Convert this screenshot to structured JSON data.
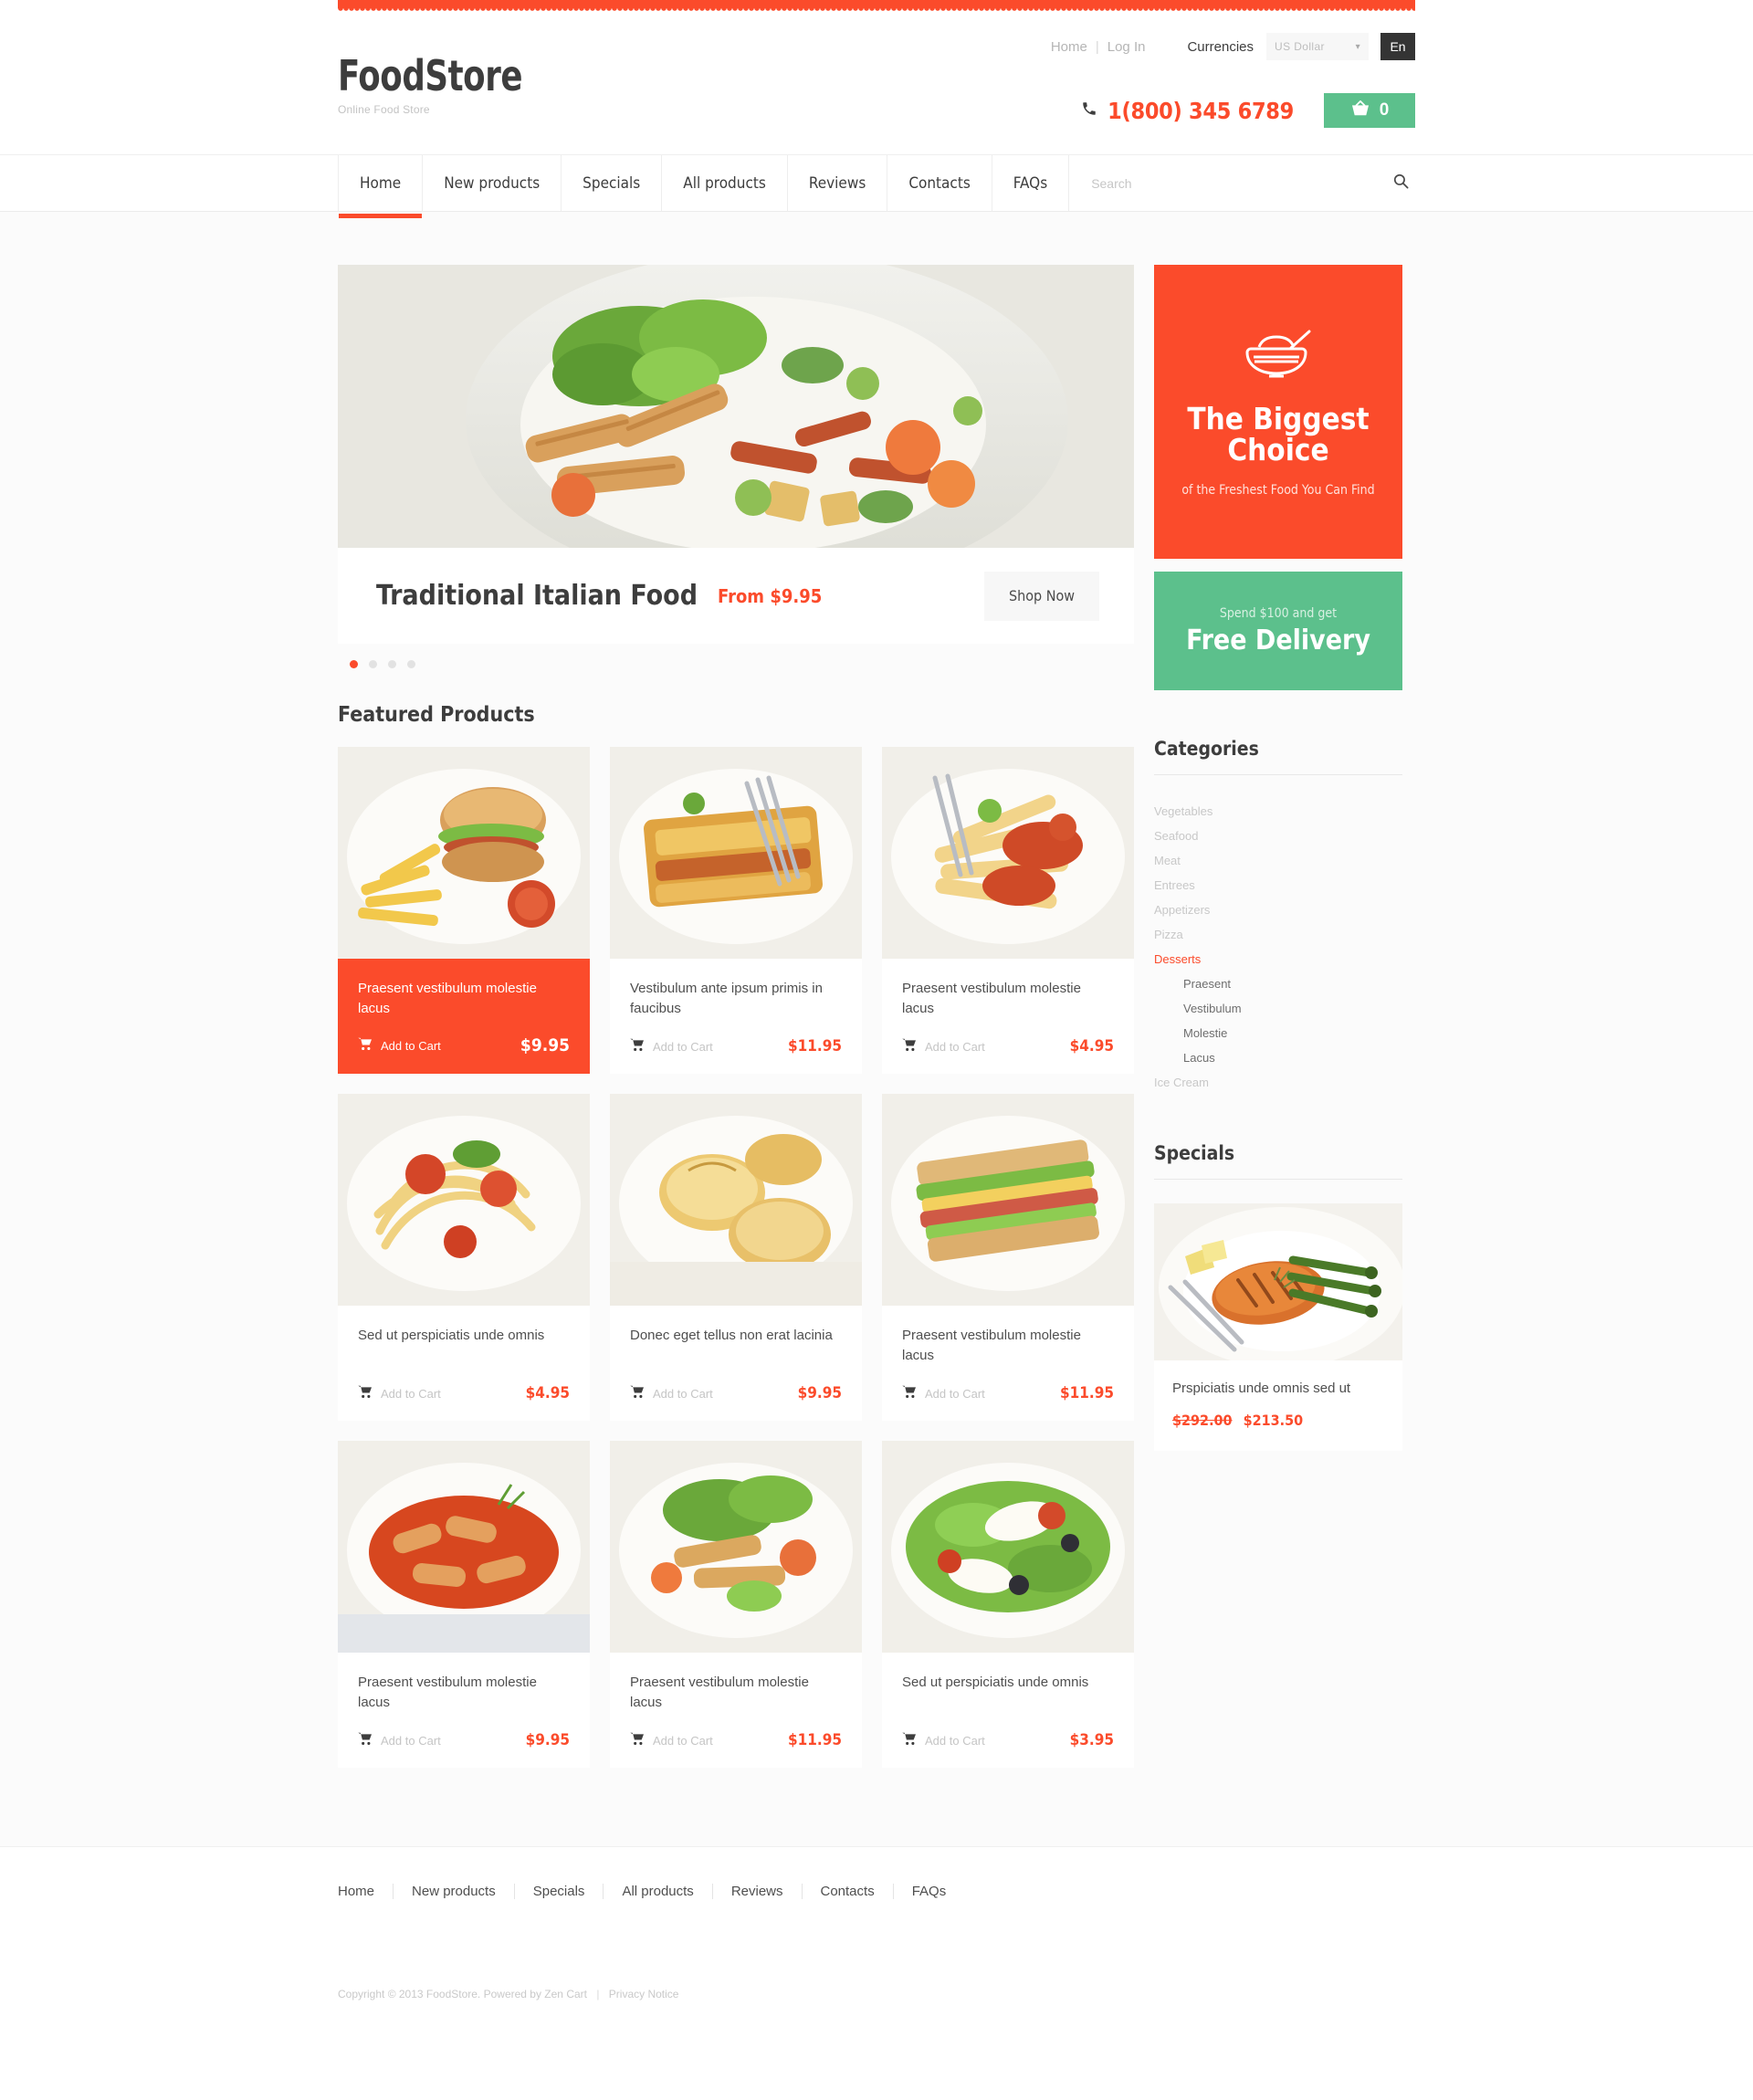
{
  "topbar": {
    "home_label": "Home",
    "separator": "|",
    "login_label": "Log In",
    "currencies_label": "Currencies",
    "currency_value": "US Dollar",
    "chevron": "⌄",
    "lang_label": "En"
  },
  "brand": {
    "title": "FoodStore",
    "tagline": "Online Food Store"
  },
  "contact": {
    "phone_icon": "phone-icon",
    "phone": "1(800) 345 6789",
    "cart_icon": "basket-icon",
    "cart_count": "0"
  },
  "nav": {
    "items": [
      {
        "label": "Home",
        "active": true
      },
      {
        "label": "New products",
        "active": false
      },
      {
        "label": "Specials",
        "active": false
      },
      {
        "label": "All products",
        "active": false
      },
      {
        "label": "Reviews",
        "active": false
      },
      {
        "label": "Contacts",
        "active": false
      },
      {
        "label": "FAQs",
        "active": false
      }
    ]
  },
  "search": {
    "placeholder": "Search",
    "icon": "search-icon"
  },
  "slider": {
    "title": "Traditional Italian Food",
    "price": "From $9.95",
    "button": "Shop Now",
    "dots": [
      true,
      false,
      false,
      false
    ]
  },
  "featured": {
    "heading": "Featured Products",
    "add_to_cart": "Add to Cart",
    "products": [
      {
        "title": "Praesent vestibulum molestie lacus",
        "price": "$9.95",
        "highlight": true
      },
      {
        "title": "Vestibulum ante ipsum primis in faucibus",
        "price": "$11.95",
        "highlight": false
      },
      {
        "title": "Praesent vestibulum molestie lacus",
        "price": "$4.95",
        "highlight": false
      },
      {
        "title": "Sed ut perspiciatis unde omnis",
        "price": "$4.95",
        "highlight": false
      },
      {
        "title": "Donec eget tellus non erat lacinia",
        "price": "$9.95",
        "highlight": false
      },
      {
        "title": "Praesent vestibulum molestie lacus",
        "price": "$11.95",
        "highlight": false
      },
      {
        "title": "Praesent vestibulum molestie lacus",
        "price": "$9.95",
        "highlight": false
      },
      {
        "title": "Praesent vestibulum molestie lacus",
        "price": "$11.95",
        "highlight": false
      },
      {
        "title": "Sed ut perspiciatis unde omnis",
        "price": "$3.95",
        "highlight": false
      }
    ]
  },
  "banners": {
    "orange": {
      "icon": "rice-bowl-icon",
      "line1": "The Biggest",
      "line2": "Choice",
      "sub": "of the Freshest Food You Can Find"
    },
    "green": {
      "small": "Spend $100 and get",
      "big": "Free Delivery"
    }
  },
  "categories": {
    "heading": "Categories",
    "items": [
      {
        "label": "Vegetables",
        "active": false,
        "sub": false
      },
      {
        "label": "Seafood",
        "active": false,
        "sub": false
      },
      {
        "label": "Meat",
        "active": false,
        "sub": false
      },
      {
        "label": "Entrees",
        "active": false,
        "sub": false
      },
      {
        "label": "Appetizers",
        "active": false,
        "sub": false
      },
      {
        "label": "Pizza",
        "active": false,
        "sub": false
      },
      {
        "label": "Desserts",
        "active": true,
        "sub": false
      },
      {
        "label": "Praesent",
        "active": false,
        "sub": true
      },
      {
        "label": "Vestibulum",
        "active": false,
        "sub": true
      },
      {
        "label": "Molestie",
        "active": false,
        "sub": true
      },
      {
        "label": "Lacus",
        "active": false,
        "sub": true
      },
      {
        "label": "Ice Cream",
        "active": false,
        "sub": false
      }
    ]
  },
  "specials": {
    "heading": "Specials",
    "title": "Prspiciatis unde omnis sed ut",
    "old_price": "$292.00",
    "new_price": "$213.50"
  },
  "footer": {
    "links": [
      "Home",
      "New products",
      "Specials",
      "All products",
      "Reviews",
      "Contacts",
      "FAQs"
    ],
    "copyright": "Copyright © 2013 FoodStore. Powered by Zen Cart",
    "sep": "|",
    "privacy": "Privacy Notice"
  },
  "colors": {
    "accent_orange": "#fb4b2b",
    "accent_green": "#5cc08c",
    "text_dark": "#3d3d3d",
    "text_muted": "#c5c5c5"
  }
}
